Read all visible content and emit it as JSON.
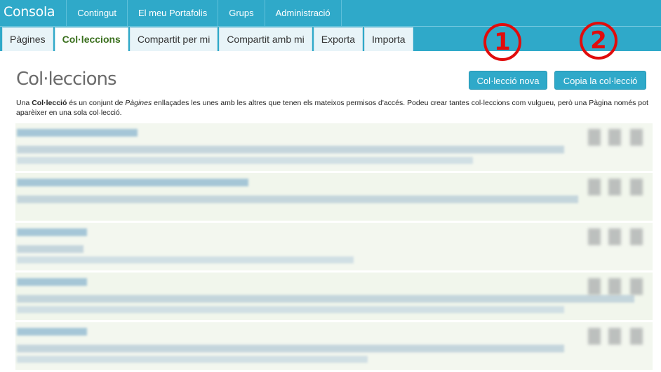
{
  "brand": "Consola",
  "top_nav": [
    "Contingut",
    "El meu Portafolis",
    "Grups",
    "Administració"
  ],
  "sub_nav": [
    {
      "label": "Pàgines",
      "active": false
    },
    {
      "label": "Col·leccions",
      "active": true
    },
    {
      "label": "Compartit per mi",
      "active": false
    },
    {
      "label": "Compartit amb mi",
      "active": false
    },
    {
      "label": "Exporta",
      "active": false
    },
    {
      "label": "Importa",
      "active": false
    }
  ],
  "annotations": {
    "one": "1",
    "two": "2"
  },
  "page": {
    "title": "Col·leccions",
    "new_button": "Col·lecció nova",
    "copy_button": "Copia la col·lecció",
    "desc_part1": "Una ",
    "desc_bold": "Col·lecció",
    "desc_part2": " és un conjunt de ",
    "desc_italic": "Pàgines",
    "desc_part3": " enllaçades les unes amb les altres que tenen els mateixos permisos d'accés. Podeu crear tantes col·leccions com vulgueu, però una Pàgina només pot aparèixer en una sola col·lecció."
  },
  "colors": {
    "brand": "#2fa9c9",
    "active_tab_text": "#3a6f1d",
    "annotation": "#e10c0c"
  }
}
